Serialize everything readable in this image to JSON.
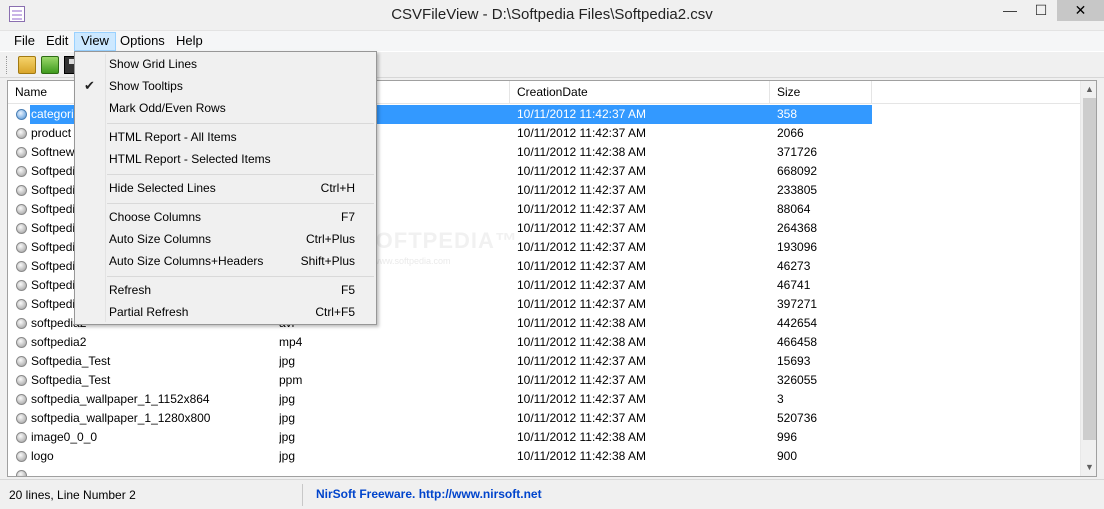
{
  "window": {
    "title": "CSVFileView  -  D:\\Softpedia Files\\Softpedia2.csv",
    "minimize": "—",
    "maximize": "☐",
    "close": "✕"
  },
  "menu": [
    "File",
    "Edit",
    "View",
    "Options",
    "Help"
  ],
  "toolbar": {
    "icons": [
      "open-folder-icon",
      "open-green-folder-icon",
      "save-icon"
    ]
  },
  "view_menu": {
    "items": [
      {
        "label": "Show Grid Lines",
        "shortcut": "",
        "checked": false
      },
      {
        "label": "Show Tooltips",
        "shortcut": "",
        "checked": true
      },
      {
        "label": "Mark Odd/Even Rows",
        "shortcut": "",
        "checked": false
      },
      {
        "label": "HTML Report - All Items",
        "shortcut": "",
        "checked": false
      },
      {
        "label": "HTML Report - Selected Items",
        "shortcut": "",
        "checked": false
      },
      {
        "label": "Hide Selected Lines",
        "shortcut": "Ctrl+H",
        "checked": false
      },
      {
        "label": "Choose Columns",
        "shortcut": "F7",
        "checked": false
      },
      {
        "label": "Auto Size Columns",
        "shortcut": "Ctrl+Plus",
        "checked": false
      },
      {
        "label": "Auto Size Columns+Headers",
        "shortcut": "Shift+Plus",
        "checked": false
      },
      {
        "label": "Refresh",
        "shortcut": "F5",
        "checked": false
      },
      {
        "label": "Partial Refresh",
        "shortcut": "Ctrl+F5",
        "checked": false
      }
    ],
    "check_glyph": "✔"
  },
  "table": {
    "columns": [
      "Name",
      "",
      "CreationDate",
      "Size"
    ],
    "rows": [
      {
        "name": "categori",
        "ext": "",
        "date": "10/11/2012 11:42:37 AM",
        "size": "358",
        "selected": true
      },
      {
        "name": "product",
        "ext": "",
        "date": "10/11/2012 11:42:37 AM",
        "size": "2066"
      },
      {
        "name": "Softnew",
        "ext": "",
        "date": "10/11/2012 11:42:38 AM",
        "size": "371726"
      },
      {
        "name": "Softpedi",
        "ext": "",
        "date": "10/11/2012 11:42:37 AM",
        "size": "668092"
      },
      {
        "name": "Softpedi",
        "ext": "",
        "date": "10/11/2012 11:42:37 AM",
        "size": "233805"
      },
      {
        "name": "Softpedi",
        "ext": "",
        "date": "10/11/2012 11:42:37 AM",
        "size": "88064"
      },
      {
        "name": "Softpedi",
        "ext": "",
        "date": "10/11/2012 11:42:37 AM",
        "size": "264368"
      },
      {
        "name": "Softpedi",
        "ext": "",
        "date": "10/11/2012 11:42:37 AM",
        "size": "193096"
      },
      {
        "name": "Softpedi",
        "ext": "",
        "date": "10/11/2012 11:42:37 AM",
        "size": "46273"
      },
      {
        "name": "Softpedi",
        "ext": "",
        "date": "10/11/2012 11:42:37 AM",
        "size": "46741"
      },
      {
        "name": "Softpedi",
        "ext": "",
        "date": "10/11/2012 11:42:37 AM",
        "size": "397271"
      },
      {
        "name": "softpedia2",
        "ext": "avi",
        "date": "10/11/2012 11:42:38 AM",
        "size": "442654"
      },
      {
        "name": "softpedia2",
        "ext": "mp4",
        "date": "10/11/2012 11:42:38 AM",
        "size": "466458"
      },
      {
        "name": "Softpedia_Test",
        "ext": "jpg",
        "date": "10/11/2012 11:42:37 AM",
        "size": "15693"
      },
      {
        "name": "Softpedia_Test",
        "ext": "ppm",
        "date": "10/11/2012 11:42:37 AM",
        "size": "326055"
      },
      {
        "name": "softpedia_wallpaper_1_1152x864",
        "ext": "jpg",
        "date": "10/11/2012 11:42:37 AM",
        "size": "3"
      },
      {
        "name": "softpedia_wallpaper_1_1280x800",
        "ext": "jpg",
        "date": "10/11/2012 11:42:37 AM",
        "size": "520736"
      },
      {
        "name": "image0_0_0",
        "ext": "jpg",
        "date": "10/11/2012 11:42:38 AM",
        "size": "996"
      },
      {
        "name": "logo",
        "ext": "jpg",
        "date": "10/11/2012 11:42:38 AM",
        "size": "900"
      },
      {
        "name": "",
        "ext": "",
        "date": "",
        "size": ""
      }
    ]
  },
  "watermark": {
    "text": "SOFTPEDIA™",
    "url": "www.softpedia.com"
  },
  "status": {
    "left": "20 lines, Line Number 2",
    "link": "NirSoft Freeware.  http://www.nirsoft.net"
  },
  "scrollbar": {
    "up": "▲",
    "down": "▼"
  },
  "colors": {
    "selection": "#3399ff",
    "menu_highlight": "#cce8ff",
    "link": "#0044cc"
  }
}
